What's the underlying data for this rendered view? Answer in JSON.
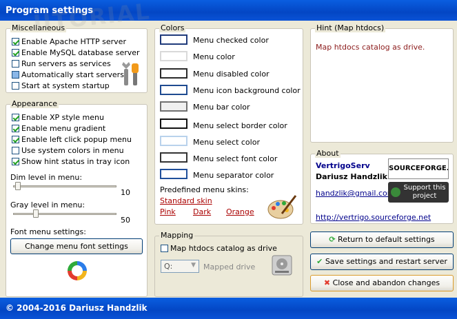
{
  "window": {
    "title": "Program settings",
    "footer": "© 2004-2016 Dariusz Handzlik"
  },
  "misc": {
    "title": "Miscellaneous",
    "items": [
      {
        "label": "Enable Apache HTTP server",
        "checked": true
      },
      {
        "label": "Enable MySQL database server",
        "checked": true
      },
      {
        "label": "Run servers as services",
        "checked": false
      },
      {
        "label": "Automatically start servers",
        "checked": false
      },
      {
        "label": "Start at system startup",
        "checked": false
      }
    ]
  },
  "appearance": {
    "title": "Appearance",
    "items": [
      {
        "label": "Enable XP style menu",
        "checked": true
      },
      {
        "label": "Enable menu gradient",
        "checked": true
      },
      {
        "label": "Enable left click popup menu",
        "checked": true
      },
      {
        "label": "Use system colors in menu",
        "checked": false
      },
      {
        "label": "Show hint status in tray icon",
        "checked": true
      }
    ],
    "dim_label": "Dim level in menu:",
    "dim_value": "10",
    "gray_label": "Gray level in menu:",
    "gray_value": "50",
    "font_label": "Font menu settings:",
    "font_button": "Change menu font settings"
  },
  "colors": {
    "title": "Colors",
    "items": [
      {
        "label": "Menu checked color",
        "border": "#1f3a7a",
        "fill": "#ffffff"
      },
      {
        "label": "Menu color",
        "border": "#d9d9d9",
        "fill": "#ffffff"
      },
      {
        "label": "Menu disabled color",
        "border": "#2a2a2a",
        "fill": "#ffffff"
      },
      {
        "label": "Menu icon background color",
        "border": "#1e4a90",
        "fill": "#ffffff"
      },
      {
        "label": "Menu bar color",
        "border": "#707070",
        "fill": "#f0f0f0"
      },
      {
        "label": "Menu select border color",
        "border": "#111111",
        "fill": "#ffffff"
      },
      {
        "label": "Menu select color",
        "border": "#b9d2ec",
        "fill": "#ffffff"
      },
      {
        "label": "Menu select font color",
        "border": "#333333",
        "fill": "#ffffff"
      },
      {
        "label": "Menu separator color",
        "border": "#1f4f9a",
        "fill": "#ffffff"
      }
    ],
    "skins_label": "Predefined menu skins:",
    "skins": [
      "Standard skin",
      "Pink",
      "Dark",
      "Orange"
    ]
  },
  "mapping": {
    "title": "Mapping",
    "checkbox": "Map htdocs catalog as drive",
    "drive": "Q:",
    "drive_label": "Mapped drive"
  },
  "hint": {
    "title": "Hint (Map htdocs)",
    "text": "Map htdocs catalog as drive."
  },
  "about": {
    "title": "About",
    "product": "VertrigoServ",
    "author": "Dariusz Handzlik",
    "email": "handzlik@gmail.com",
    "url": "http://vertrigo.sourceforge.net",
    "sf_logo": "SOURCEFORGE.net",
    "support": "Support this project"
  },
  "buttons": {
    "defaults": "Return to default settings",
    "save": "Save settings and restart server",
    "close": "Close and abandon changes"
  },
  "watermark": "UTORIAL"
}
